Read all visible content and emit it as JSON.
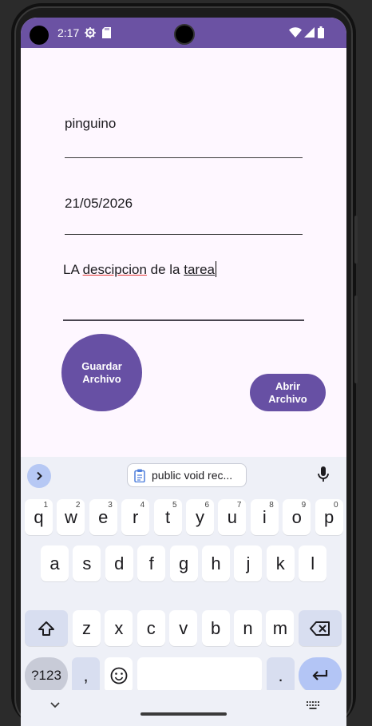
{
  "status": {
    "time": "2:17"
  },
  "form": {
    "name_value": "pinguino",
    "date_value": "21/05/2026",
    "desc_prefix": "LA ",
    "desc_misspelled": "descipcion",
    "desc_middle": " de la ",
    "desc_last": "tarea"
  },
  "buttons": {
    "save": "Guardar Archivo",
    "open": "Abrir Archivo"
  },
  "keyboard": {
    "suggestion": "public void rec...",
    "row1": [
      {
        "k": "q",
        "h": "1"
      },
      {
        "k": "w",
        "h": "2"
      },
      {
        "k": "e",
        "h": "3"
      },
      {
        "k": "r",
        "h": "4"
      },
      {
        "k": "t",
        "h": "5"
      },
      {
        "k": "y",
        "h": "6"
      },
      {
        "k": "u",
        "h": "7"
      },
      {
        "k": "i",
        "h": "8"
      },
      {
        "k": "o",
        "h": "9"
      },
      {
        "k": "p",
        "h": "0"
      }
    ],
    "row2": [
      "a",
      "s",
      "d",
      "f",
      "g",
      "h",
      "j",
      "k",
      "l"
    ],
    "row3": [
      "z",
      "x",
      "c",
      "v",
      "b",
      "n",
      "m"
    ],
    "sym_label": "?123",
    "comma": ",",
    "period": "."
  },
  "colors": {
    "accent": "#6750a4",
    "status_bar": "#6b52a3",
    "background": "#fef7ff"
  }
}
